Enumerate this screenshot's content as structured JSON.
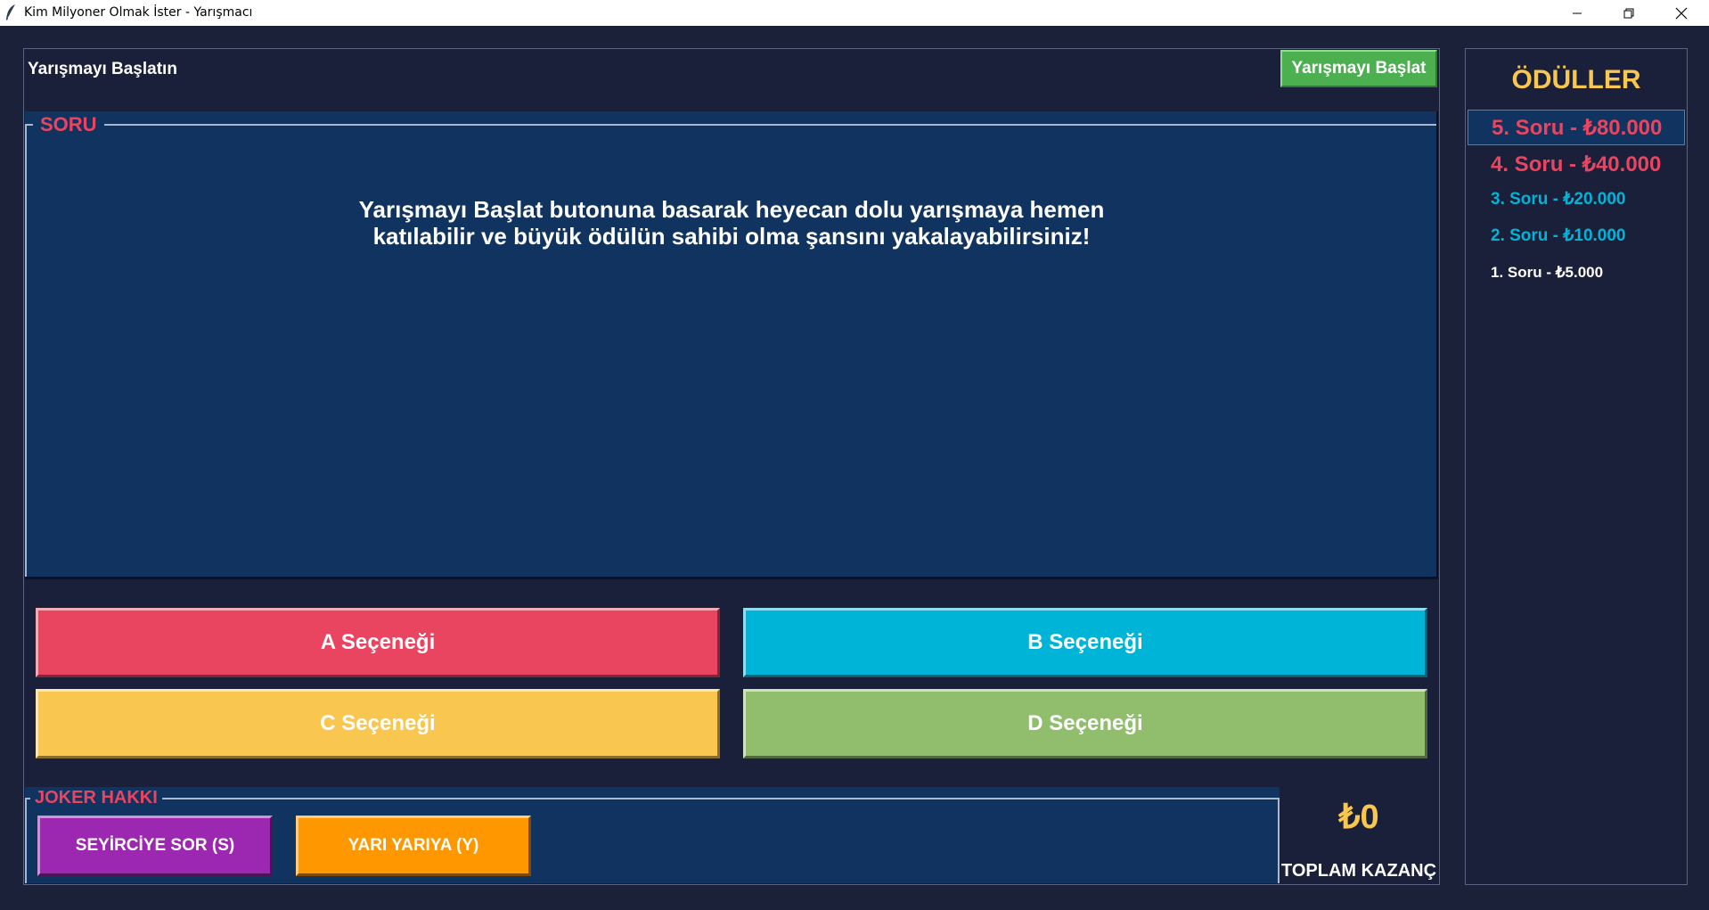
{
  "window": {
    "title": "Kim Milyoner Olmak İster - Yarışmacı",
    "icons": [
      "feather-icon",
      "minimize-icon",
      "restore-icon",
      "close-icon"
    ]
  },
  "header": {
    "status": "Yarışmayı Başlatın",
    "start_button": "Yarışmayı Başlat"
  },
  "question": {
    "legend": "SORU",
    "text_line1": "Yarışmayı Başlat butonuna basarak heyecan dolu yarışmaya hemen",
    "text_line2": "katılabilir ve büyük ödülün sahibi olma şansını yakalayabilirsiniz!"
  },
  "options": {
    "a": "A Seçeneği",
    "b": "B Seçeneği",
    "c": "C Seçeneği",
    "d": "D Seçeneği"
  },
  "jokers": {
    "legend": "JOKER HAKKI",
    "audience": "SEYİRCİYE SOR (S)",
    "fifty_fifty": "YARI YARIYA (Y)"
  },
  "earnings": {
    "amount": "₺0",
    "label": "TOPLAM KAZANÇ"
  },
  "prizes": {
    "title": "ÖDÜLLER",
    "items": [
      "5. Soru - ₺80.000",
      "4. Soru - ₺40.000",
      "3. Soru - ₺20.000",
      "2. Soru - ₺10.000",
      "1. Soru - ₺5.000"
    ]
  },
  "colors": {
    "background": "#1a1f3a",
    "question_bg": "#10335f",
    "accent_red": "#e94560",
    "accent_cyan": "#00b4d8",
    "accent_yellow": "#f9c74f",
    "accent_green": "#90be6d",
    "start_green": "#4caf50",
    "joker_purple": "#9c27b0",
    "joker_orange": "#ff9800"
  }
}
